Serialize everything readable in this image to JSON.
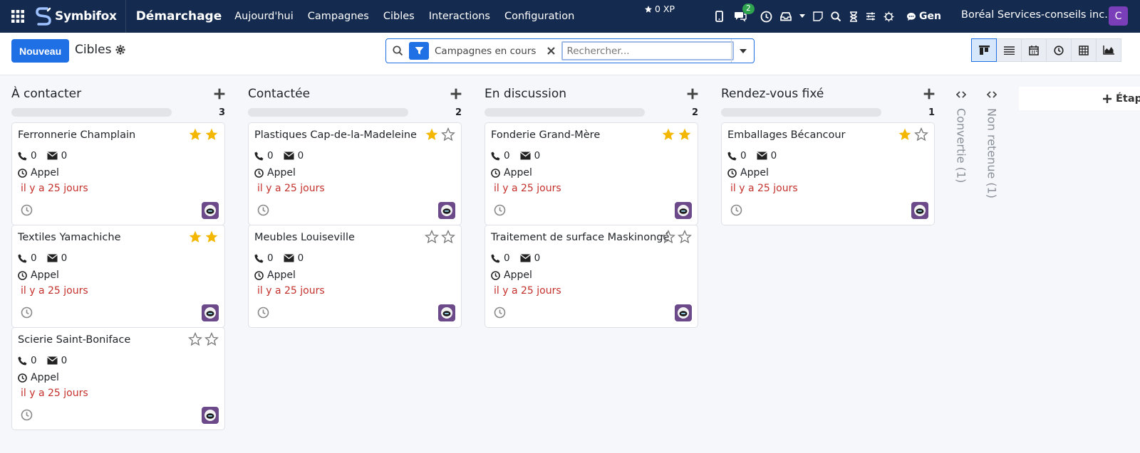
{
  "topbar": {
    "brand": "Symbifox",
    "app": "Démarchage",
    "menu": [
      "Aujourd'hui",
      "Campagnes",
      "Cibles",
      "Interactions",
      "Configuration"
    ],
    "xp": "0 XP",
    "chat_badge": "2",
    "gen": "Gen",
    "company": "Boréal Services-conseils inc.",
    "user_initial": "C"
  },
  "control": {
    "new_button": "Nouveau",
    "breadcrumb": "Cibles",
    "facet": "Campagnes en cours",
    "search_placeholder": "Rechercher..."
  },
  "columns": [
    {
      "title": "À contacter",
      "count": "3",
      "cards": [
        {
          "name": "Ferronnerie Champlain",
          "stars": 2,
          "calls": "0",
          "mails": "0",
          "activity": "Appel",
          "date": "il y a 25 jours"
        },
        {
          "name": "Textiles Yamachiche",
          "stars": 2,
          "calls": "0",
          "mails": "0",
          "activity": "Appel",
          "date": "il y a 25 jours"
        },
        {
          "name": "Scierie Saint-Boniface",
          "stars": 0,
          "calls": "0",
          "mails": "0",
          "activity": "Appel",
          "date": "il y a 25 jours"
        }
      ]
    },
    {
      "title": "Contactée",
      "count": "2",
      "cards": [
        {
          "name": "Plastiques Cap-de-la-Madeleine",
          "stars": 1,
          "calls": "0",
          "mails": "0",
          "activity": "Appel",
          "date": "il y a 25 jours"
        },
        {
          "name": "Meubles Louiseville",
          "stars": 0,
          "calls": "0",
          "mails": "0",
          "activity": "Appel",
          "date": "il y a 25 jours"
        }
      ]
    },
    {
      "title": "En discussion",
      "count": "2",
      "cards": [
        {
          "name": "Fonderie Grand-Mère",
          "stars": 2,
          "calls": "0",
          "mails": "0",
          "activity": "Appel",
          "date": "il y a 25 jours"
        },
        {
          "name": "Traitement de surface Maskinongé",
          "stars": 0,
          "calls": "0",
          "mails": "0",
          "activity": "Appel",
          "date": "il y a 25 jours"
        }
      ]
    },
    {
      "title": "Rendez-vous fixé",
      "count": "1",
      "cards": [
        {
          "name": "Emballages Bécancour",
          "stars": 1,
          "calls": "0",
          "mails": "0",
          "activity": "Appel",
          "date": "il y a 25 jours"
        }
      ]
    }
  ],
  "folded": [
    "Convertie (1)",
    "Non retenue (1)"
  ],
  "add_stage": "Étap",
  "colors": {
    "nav": "#142a4e",
    "primary": "#1f6fe5",
    "star": "#f3b700",
    "overdue": "#c4302b"
  }
}
